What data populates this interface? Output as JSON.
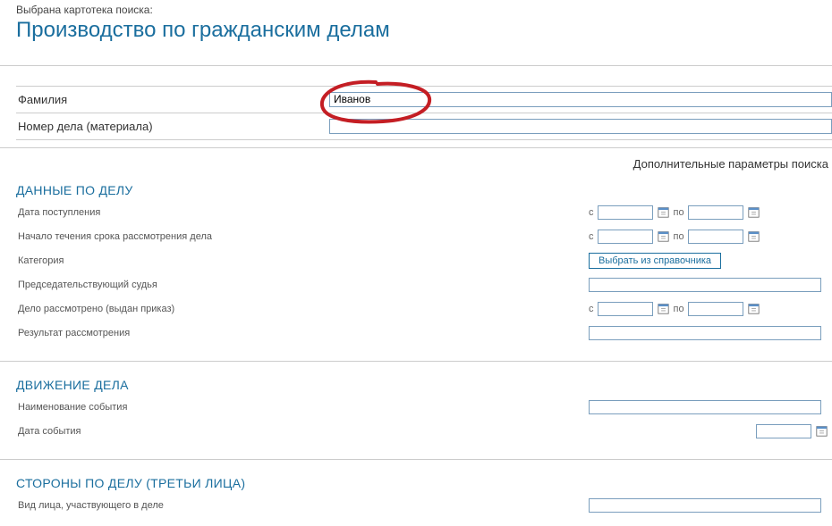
{
  "header": {
    "pre_title": "Выбрана картотека поиска:",
    "title": "Производство по гражданским делам"
  },
  "top_fields": {
    "surname_label": "Фамилия",
    "surname_value": "Иванов",
    "case_number_label": "Номер дела (материала)",
    "case_number_value": ""
  },
  "extra_params_label": "Дополнительные параметры поиска",
  "section_case": {
    "title": "ДАННЫЕ ПО ДЕЛУ",
    "receipt_date_label": "Дата поступления",
    "review_start_label": "Начало течения срока рассмотрения дела",
    "category_label": "Категория",
    "category_btn": "Выбрать из справочника",
    "judge_label": "Председательствующий судья",
    "reviewed_label": "Дело рассмотрено (выдан приказ)",
    "result_label": "Результат рассмотрения",
    "from": "с",
    "to": "по"
  },
  "section_movement": {
    "title": "ДВИЖЕНИЕ ДЕЛА",
    "event_name_label": "Наименование события",
    "event_date_label": "Дата события"
  },
  "section_parties": {
    "title": "СТОРОНЫ ПО ДЕЛУ (ТРЕТЬИ ЛИЦА)",
    "party_type_label": "Вид лица, участвующего в деле"
  }
}
